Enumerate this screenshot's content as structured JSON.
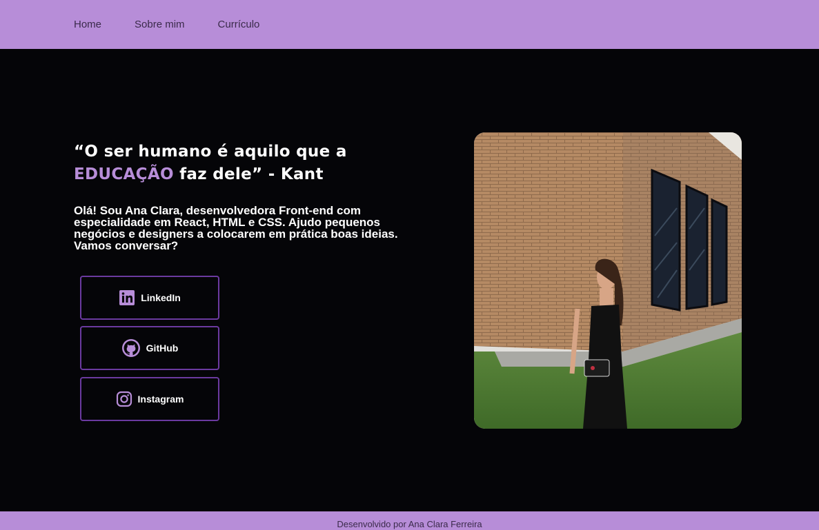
{
  "nav": {
    "items": [
      {
        "label": "Home"
      },
      {
        "label": "Sobre mim"
      },
      {
        "label": "Currículo"
      }
    ]
  },
  "hero": {
    "quote_part1": "“O ser humano é aquilo que a",
    "quote_accent": "EDUCAÇÃO",
    "quote_part2": " faz dele” - Kant",
    "intro": "Olá! Sou Ana Clara, desenvolvedora Front-end com especialidade em React, HTML e CSS. Ajudo pequenos negócios e designers a colocarem em prática boas ideias. Vamos conversar?"
  },
  "social": {
    "linkedin_label": "LinkedIn",
    "linkedin_icon": "linkedin-icon",
    "github_label": "GitHub",
    "github_icon": "github-icon",
    "instagram_label": "Instagram",
    "instagram_icon": "instagram-icon"
  },
  "photo": {
    "icon": "profile-photo"
  },
  "footer": {
    "text": "Desenvolvido por Ana Clara Ferreira"
  },
  "colors": {
    "accent": "#b78dd8",
    "background": "#050508",
    "button_border": "#6b3aa0"
  }
}
